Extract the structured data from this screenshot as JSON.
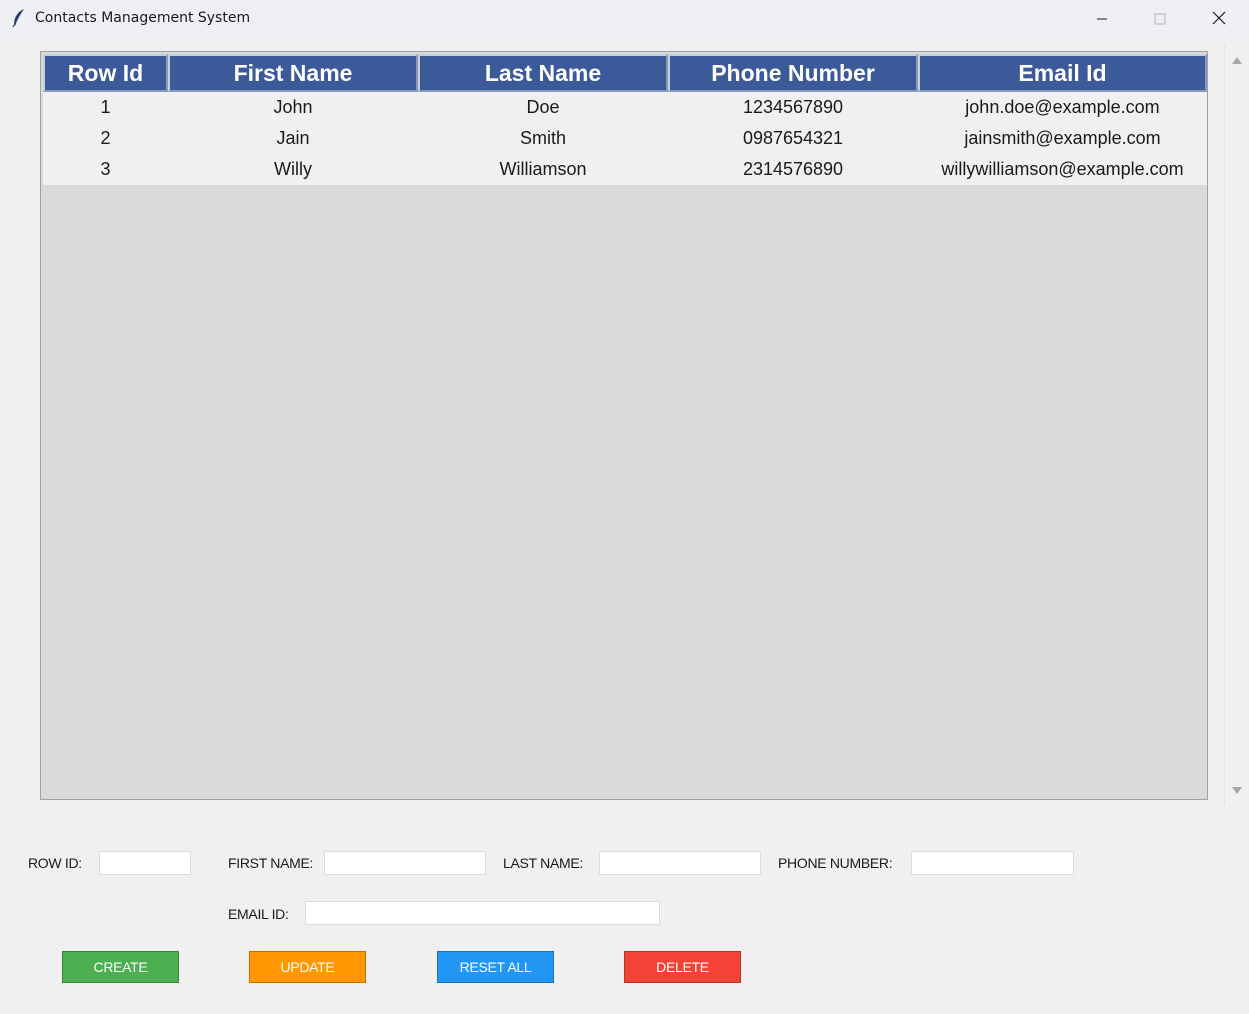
{
  "window": {
    "title": "Contacts Management System"
  },
  "table": {
    "headers": [
      "Row Id",
      "First Name",
      "Last Name",
      "Phone Number",
      "Email Id"
    ],
    "rows": [
      [
        "1",
        "John",
        "Doe",
        "1234567890",
        "john.doe@example.com"
      ],
      [
        "2",
        "Jain",
        "Smith",
        "0987654321",
        "jainsmith@example.com"
      ],
      [
        "3",
        "Willy",
        "Williamson",
        "2314576890",
        "willywilliamson@example.com"
      ]
    ]
  },
  "form": {
    "row_id_label": "ROW ID:",
    "first_name_label": "FIRST NAME:",
    "last_name_label": "LAST NAME:",
    "phone_number_label": "PHONE NUMBER:",
    "email_id_label": "EMAIL ID:",
    "row_id_value": "",
    "first_name_value": "",
    "last_name_value": "",
    "phone_number_value": "",
    "email_id_value": ""
  },
  "buttons": {
    "create": "CREATE",
    "update": "UPDATE",
    "reset_all": "RESET ALL",
    "delete": "DELETE"
  },
  "colors": {
    "header_bg": "#3c5a99",
    "create": "#4caf50",
    "update": "#ff9800",
    "reset_all": "#2196f3",
    "delete": "#f44336"
  },
  "icons": {
    "app": "feather-icon",
    "minimize": "minimize-icon",
    "maximize": "maximize-icon",
    "close": "close-icon"
  }
}
